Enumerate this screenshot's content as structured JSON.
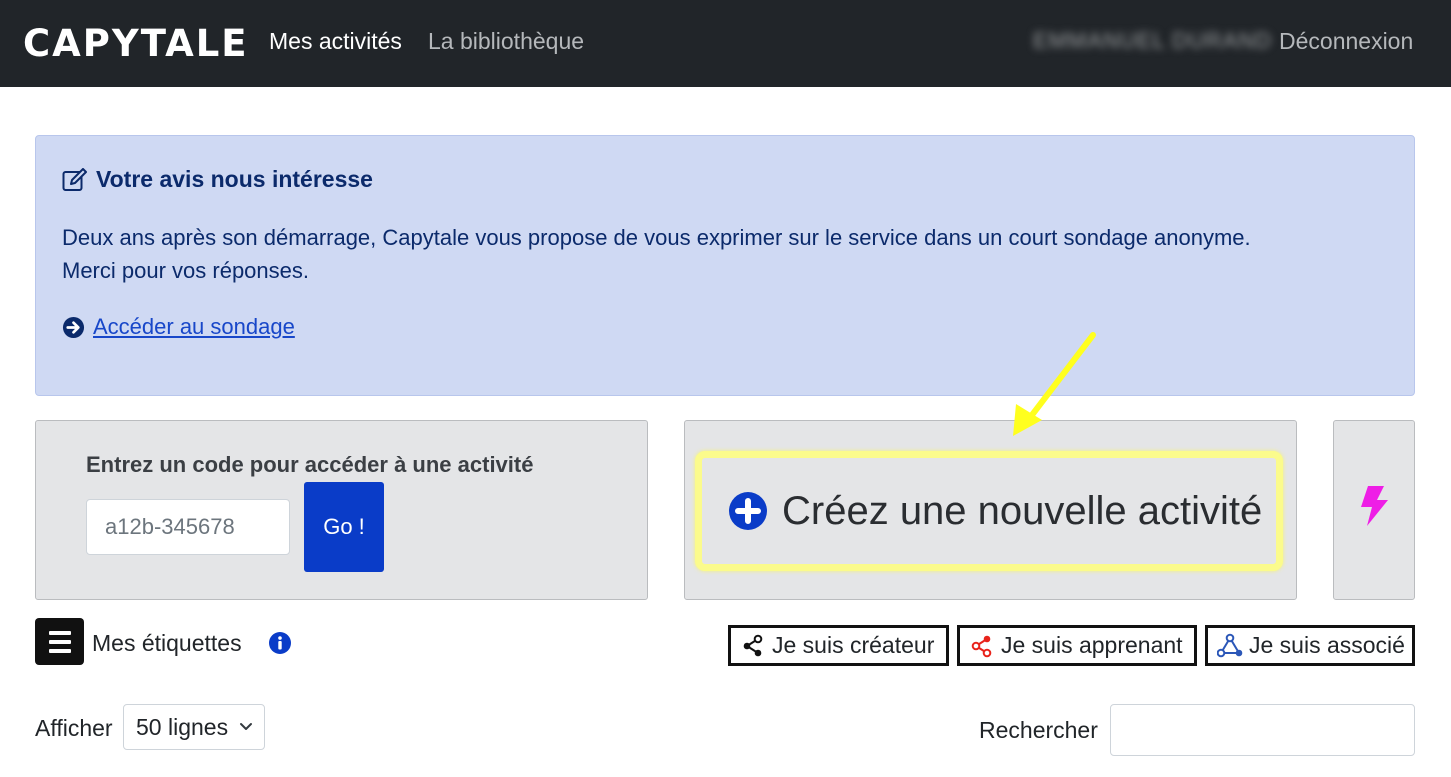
{
  "header": {
    "brand": "CAPYTALE",
    "nav": [
      "Mes activités",
      "La bibliothèque"
    ],
    "user_name": "EMMANUEL DURAND",
    "logout": "Déconnexion"
  },
  "alert": {
    "icon": "edit-icon",
    "title": "Votre avis nous intéresse",
    "text_line1": "Deux ans après son démarrage, Capytale vous propose de vous exprimer sur le service dans un court sondage anonyme.",
    "text_line2": "Merci pour vos réponses.",
    "link_icon": "arrow-circle-right-icon",
    "link_label": "Accéder au sondage"
  },
  "code_panel": {
    "label": "Entrez un code pour accéder à une activité",
    "placeholder": "a12b-345678",
    "go_label": "Go !"
  },
  "create_panel": {
    "icon": "plus-circle-icon",
    "label": "Créez une nouvelle activité"
  },
  "flash_panel": {
    "icon": "lightning-bolt-icon"
  },
  "tags": {
    "icon": "hamburger-icon",
    "label": "Mes étiquettes",
    "info_icon": "info-circle-icon"
  },
  "roles": {
    "creator": "Je suis créateur",
    "learner": "Je suis apprenant",
    "associate": "Je suis associé"
  },
  "table_controls": {
    "show_label": "Afficher",
    "show_value": "50 lignes",
    "search_label": "Rechercher",
    "search_value": ""
  },
  "colors": {
    "topbar": "#212529",
    "alert_bg": "#cfd9f3",
    "primary": "#0a3cc8",
    "highlight": "#fbfb8c",
    "flash": "#ee1ee6",
    "learner_share": "#e8231b",
    "associate_icon": "#2b57b8"
  }
}
